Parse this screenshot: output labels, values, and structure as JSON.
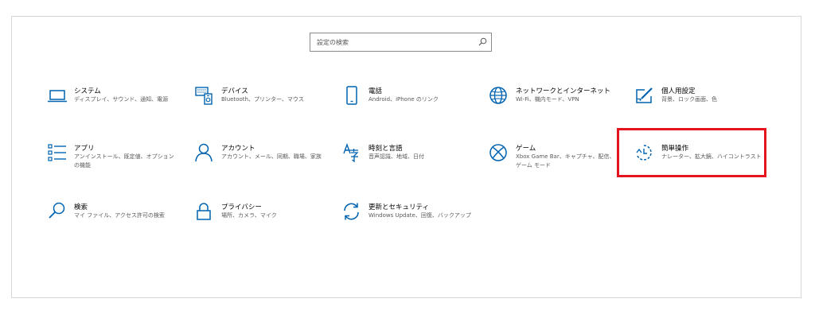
{
  "search": {
    "placeholder": "設定の検索"
  },
  "accent_color": "#0063b1",
  "highlight_color": "#e3141e",
  "tiles": [
    {
      "icon": "laptop-icon",
      "title": "システム",
      "desc": "ディスプレイ、サウンド、通知、電源"
    },
    {
      "icon": "devices-icon",
      "title": "デバイス",
      "desc": "Bluetooth、プリンター、マウス"
    },
    {
      "icon": "phone-icon",
      "title": "電話",
      "desc": "Android、iPhone のリンク"
    },
    {
      "icon": "globe-icon",
      "title": "ネットワークとインターネット",
      "desc": "Wi-Fi、機内モード、VPN"
    },
    {
      "icon": "personalization-icon",
      "title": "個人用設定",
      "desc": "背景、ロック画面、色"
    },
    {
      "icon": "apps-list-icon",
      "title": "アプリ",
      "desc": "アンインストール、既定値、オプションの機能"
    },
    {
      "icon": "person-icon",
      "title": "アカウント",
      "desc": "アカウント、メール、同期、職場、家族"
    },
    {
      "icon": "time-language-icon",
      "title": "時刻と言語",
      "desc": "音声認識、地域、日付"
    },
    {
      "icon": "xbox-icon",
      "title": "ゲーム",
      "desc": "Xbox Game Bar、キャプチャ、配信、ゲーム モード"
    },
    {
      "icon": "ease-of-access-icon",
      "title": "簡単操作",
      "desc": "ナレーター、拡大鏡、ハイコントラスト"
    },
    {
      "icon": "search-icon",
      "title": "検索",
      "desc": "マイ ファイル、アクセス許可の検索"
    },
    {
      "icon": "lock-icon",
      "title": "プライバシー",
      "desc": "場所、カメラ、マイク"
    },
    {
      "icon": "sync-icon",
      "title": "更新とセキュリティ",
      "desc": "Windows Update、回復、バックアップ"
    }
  ]
}
